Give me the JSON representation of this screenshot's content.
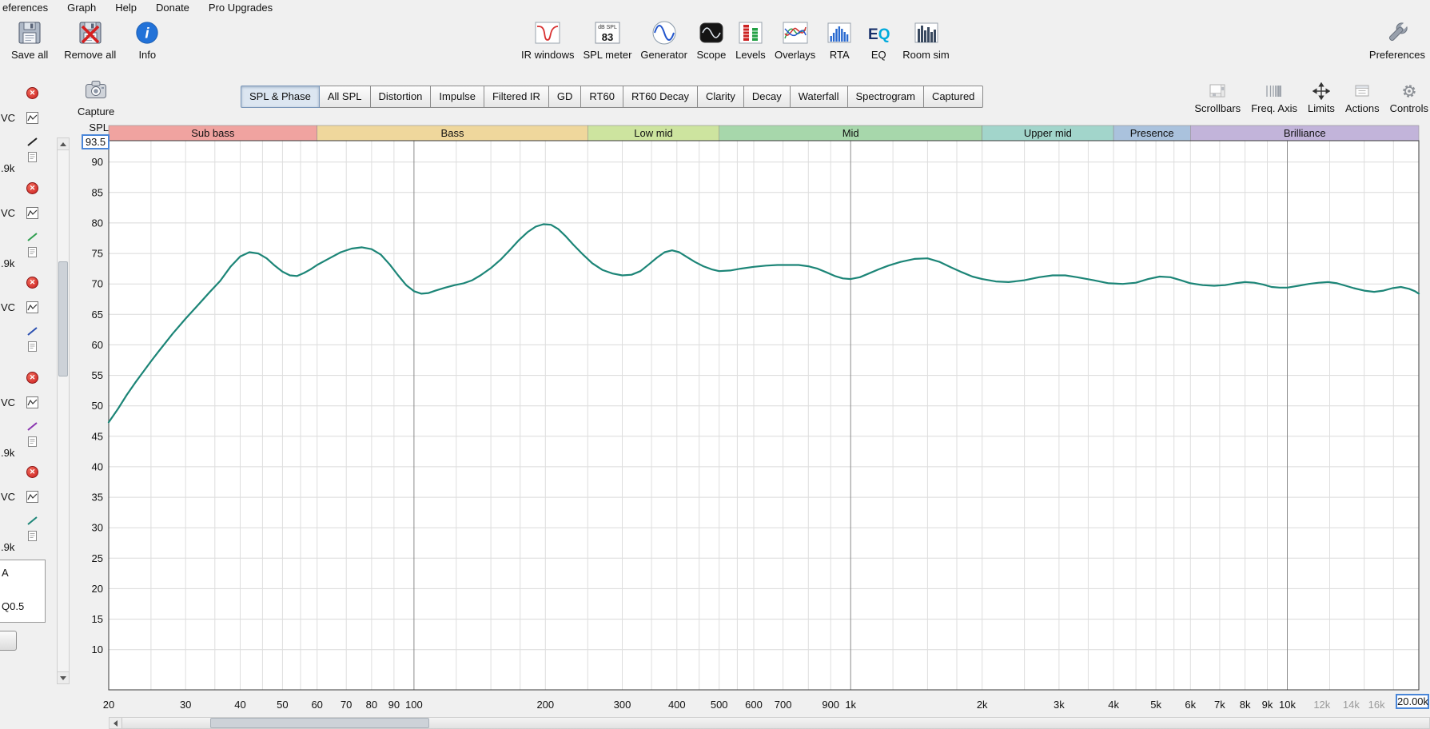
{
  "menu": {
    "items": [
      "eferences",
      "Graph",
      "Help",
      "Donate",
      "Pro Upgrades"
    ]
  },
  "toolbar": {
    "left": [
      {
        "id": "save-all",
        "label": "Save all",
        "icon": "save-icon"
      },
      {
        "id": "remove-all",
        "label": "Remove all",
        "icon": "remove-all-icon"
      },
      {
        "id": "info",
        "label": "Info",
        "icon": "info-icon"
      }
    ],
    "center": [
      {
        "id": "ir-windows",
        "label": "IR windows",
        "icon": "ir-windows-icon"
      },
      {
        "id": "spl-meter",
        "label": "SPL meter",
        "icon": "spl-meter-icon",
        "meter_caption": "dB SPL",
        "meter_value": "83"
      },
      {
        "id": "generator",
        "label": "Generator",
        "icon": "generator-icon"
      },
      {
        "id": "scope",
        "label": "Scope",
        "icon": "scope-icon"
      },
      {
        "id": "levels",
        "label": "Levels",
        "icon": "levels-icon"
      },
      {
        "id": "overlays",
        "label": "Overlays",
        "icon": "overlays-icon"
      },
      {
        "id": "rta",
        "label": "RTA",
        "icon": "rta-icon"
      },
      {
        "id": "eq",
        "label": "EQ",
        "icon": "eq-icon"
      },
      {
        "id": "room-sim",
        "label": "Room sim",
        "icon": "room-sim-icon"
      }
    ],
    "right": [
      {
        "id": "preferences",
        "label": "Preferences",
        "icon": "wrench-icon"
      }
    ]
  },
  "capture": {
    "label": "Capture"
  },
  "tabs": {
    "active": "SPL & Phase",
    "items": [
      "SPL & Phase",
      "All SPL",
      "Distortion",
      "Impulse",
      "Filtered IR",
      "GD",
      "RT60",
      "RT60 Decay",
      "Clarity",
      "Decay",
      "Waterfall",
      "Spectrogram",
      "Captured"
    ]
  },
  "graph_controls": [
    {
      "id": "scrollbars",
      "label": "Scrollbars",
      "icon": "scrollbars-icon"
    },
    {
      "id": "freq-axis",
      "label": "Freq. Axis",
      "icon": "freq-axis-icon"
    },
    {
      "id": "limits",
      "label": "Limits",
      "icon": "limits-icon"
    },
    {
      "id": "actions",
      "label": "Actions",
      "icon": "actions-icon"
    },
    {
      "id": "controls",
      "label": "Controls",
      "icon": "gear-icon"
    }
  ],
  "sidebar": {
    "items": [
      {
        "name_fragment": "VC",
        "range_fragment": ".9k",
        "trace_color": "#222222"
      },
      {
        "name_fragment": "VC",
        "range_fragment": ".9k",
        "trace_color": "#2e9e4f"
      },
      {
        "name_fragment": "VC",
        "range_fragment": "",
        "trace_color": "#2a4fb0"
      },
      {
        "name_fragment": "VC",
        "range_fragment": ".9k",
        "trace_color": "#8a35b0"
      },
      {
        "name_fragment": "VC",
        "range_fragment": ".9k",
        "trace_color": "#1c8577"
      }
    ],
    "bottom_box": {
      "line1": "A",
      "line2": "Q0.5"
    }
  },
  "chart_data": {
    "type": "line",
    "title": "",
    "xlabel": "",
    "ylabel": "SPL",
    "x_scale": "log",
    "xlim": [
      20,
      20000
    ],
    "ylim": [
      3.4,
      93.5
    ],
    "y_top_limit": "93.5",
    "x_right_limit": "20.00k",
    "grid": true,
    "y_ticks": [
      90,
      85,
      80,
      75,
      70,
      65,
      60,
      55,
      50,
      45,
      40,
      35,
      30,
      25,
      20,
      15,
      10
    ],
    "x_ticks": [
      {
        "f": 20,
        "label": "20"
      },
      {
        "f": 30,
        "label": "30"
      },
      {
        "f": 40,
        "label": "40"
      },
      {
        "f": 50,
        "label": "50"
      },
      {
        "f": 60,
        "label": "60"
      },
      {
        "f": 70,
        "label": "70"
      },
      {
        "f": 80,
        "label": "80"
      },
      {
        "f": 90,
        "label": "90"
      },
      {
        "f": 100,
        "label": "100"
      },
      {
        "f": 200,
        "label": "200"
      },
      {
        "f": 300,
        "label": "300"
      },
      {
        "f": 400,
        "label": "400"
      },
      {
        "f": 500,
        "label": "500"
      },
      {
        "f": 600,
        "label": "600"
      },
      {
        "f": 700,
        "label": "700"
      },
      {
        "f": 900,
        "label": "900"
      },
      {
        "f": 1000,
        "label": "1k"
      },
      {
        "f": 2000,
        "label": "2k"
      },
      {
        "f": 3000,
        "label": "3k"
      },
      {
        "f": 4000,
        "label": "4k"
      },
      {
        "f": 5000,
        "label": "5k"
      },
      {
        "f": 6000,
        "label": "6k"
      },
      {
        "f": 7000,
        "label": "7k"
      },
      {
        "f": 8000,
        "label": "8k"
      },
      {
        "f": 9000,
        "label": "9k"
      },
      {
        "f": 10000,
        "label": "10k"
      },
      {
        "f": 12000,
        "label": "12k",
        "muted": true
      },
      {
        "f": 14000,
        "label": "14k",
        "muted": true
      },
      {
        "f": 16000,
        "label": "16k",
        "muted": true
      }
    ],
    "x_gridlines": [
      20,
      25,
      30,
      35,
      40,
      45,
      50,
      55,
      60,
      70,
      80,
      90,
      100,
      125,
      150,
      175,
      200,
      250,
      300,
      350,
      400,
      450,
      500,
      550,
      600,
      700,
      800,
      900,
      1000,
      1250,
      1500,
      1750,
      2000,
      2500,
      3000,
      3500,
      4000,
      4500,
      5000,
      5500,
      6000,
      7000,
      8000,
      9000,
      10000,
      12500,
      15000,
      17500,
      20000
    ],
    "x_major_gridlines": [
      100,
      1000,
      10000
    ],
    "bands": [
      {
        "label": "Sub bass",
        "from": 20,
        "to": 60,
        "color": "#f0a3a0"
      },
      {
        "label": "Bass",
        "from": 60,
        "to": 250,
        "color": "#efd79c"
      },
      {
        "label": "Low mid",
        "from": 250,
        "to": 500,
        "color": "#cde49f"
      },
      {
        "label": "Mid",
        "from": 500,
        "to": 2000,
        "color": "#a7d7ab"
      },
      {
        "label": "Upper mid",
        "from": 2000,
        "to": 4000,
        "color": "#a2d5cb"
      },
      {
        "label": "Presence",
        "from": 4000,
        "to": 6000,
        "color": "#aac2dd"
      },
      {
        "label": "Brilliance",
        "from": 6000,
        "to": 20000,
        "color": "#c2b4da"
      }
    ],
    "series": [
      {
        "name": "SPL measurement",
        "color": "#1c8577",
        "points": [
          [
            20,
            47.3
          ],
          [
            21,
            49.5
          ],
          [
            22,
            51.8
          ],
          [
            23,
            53.8
          ],
          [
            24,
            55.6
          ],
          [
            25,
            57.3
          ],
          [
            26,
            58.9
          ],
          [
            28,
            61.8
          ],
          [
            30,
            64.3
          ],
          [
            32,
            66.5
          ],
          [
            34,
            68.6
          ],
          [
            36,
            70.5
          ],
          [
            38,
            72.8
          ],
          [
            40,
            74.5
          ],
          [
            42,
            75.2
          ],
          [
            44,
            75.0
          ],
          [
            46,
            74.2
          ],
          [
            48,
            73.0
          ],
          [
            50,
            72.0
          ],
          [
            52,
            71.4
          ],
          [
            54,
            71.3
          ],
          [
            56,
            71.8
          ],
          [
            58,
            72.4
          ],
          [
            60,
            73.1
          ],
          [
            64,
            74.2
          ],
          [
            68,
            75.2
          ],
          [
            72,
            75.8
          ],
          [
            76,
            76.0
          ],
          [
            80,
            75.7
          ],
          [
            84,
            74.8
          ],
          [
            88,
            73.2
          ],
          [
            92,
            71.4
          ],
          [
            96,
            69.8
          ],
          [
            100,
            68.8
          ],
          [
            104,
            68.4
          ],
          [
            108,
            68.5
          ],
          [
            112,
            68.9
          ],
          [
            118,
            69.4
          ],
          [
            124,
            69.8
          ],
          [
            130,
            70.1
          ],
          [
            136,
            70.6
          ],
          [
            142,
            71.4
          ],
          [
            150,
            72.6
          ],
          [
            158,
            74.0
          ],
          [
            166,
            75.6
          ],
          [
            174,
            77.2
          ],
          [
            182,
            78.5
          ],
          [
            190,
            79.4
          ],
          [
            198,
            79.8
          ],
          [
            206,
            79.7
          ],
          [
            214,
            79.0
          ],
          [
            222,
            77.9
          ],
          [
            232,
            76.4
          ],
          [
            244,
            74.8
          ],
          [
            256,
            73.4
          ],
          [
            270,
            72.3
          ],
          [
            285,
            71.7
          ],
          [
            300,
            71.4
          ],
          [
            315,
            71.5
          ],
          [
            330,
            72.1
          ],
          [
            345,
            73.2
          ],
          [
            360,
            74.3
          ],
          [
            375,
            75.2
          ],
          [
            390,
            75.5
          ],
          [
            405,
            75.2
          ],
          [
            420,
            74.5
          ],
          [
            440,
            73.6
          ],
          [
            460,
            72.9
          ],
          [
            480,
            72.4
          ],
          [
            500,
            72.1
          ],
          [
            530,
            72.2
          ],
          [
            560,
            72.5
          ],
          [
            600,
            72.8
          ],
          [
            640,
            73.0
          ],
          [
            680,
            73.1
          ],
          [
            720,
            73.1
          ],
          [
            760,
            73.1
          ],
          [
            800,
            72.9
          ],
          [
            840,
            72.5
          ],
          [
            880,
            71.9
          ],
          [
            920,
            71.3
          ],
          [
            960,
            70.9
          ],
          [
            1000,
            70.8
          ],
          [
            1050,
            71.1
          ],
          [
            1100,
            71.7
          ],
          [
            1160,
            72.4
          ],
          [
            1220,
            73.0
          ],
          [
            1300,
            73.6
          ],
          [
            1400,
            74.1
          ],
          [
            1500,
            74.2
          ],
          [
            1600,
            73.6
          ],
          [
            1700,
            72.7
          ],
          [
            1800,
            71.9
          ],
          [
            1900,
            71.2
          ],
          [
            2000,
            70.8
          ],
          [
            2150,
            70.4
          ],
          [
            2300,
            70.3
          ],
          [
            2500,
            70.6
          ],
          [
            2700,
            71.1
          ],
          [
            2900,
            71.4
          ],
          [
            3100,
            71.4
          ],
          [
            3300,
            71.1
          ],
          [
            3600,
            70.6
          ],
          [
            3900,
            70.1
          ],
          [
            4200,
            70.0
          ],
          [
            4500,
            70.2
          ],
          [
            4800,
            70.8
          ],
          [
            5100,
            71.2
          ],
          [
            5400,
            71.1
          ],
          [
            5700,
            70.6
          ],
          [
            6000,
            70.1
          ],
          [
            6400,
            69.8
          ],
          [
            6800,
            69.7
          ],
          [
            7200,
            69.8
          ],
          [
            7600,
            70.1
          ],
          [
            8000,
            70.3
          ],
          [
            8400,
            70.2
          ],
          [
            8800,
            69.9
          ],
          [
            9200,
            69.5
          ],
          [
            9600,
            69.4
          ],
          [
            10000,
            69.4
          ],
          [
            10600,
            69.7
          ],
          [
            11200,
            70.0
          ],
          [
            11800,
            70.2
          ],
          [
            12400,
            70.3
          ],
          [
            13000,
            70.1
          ],
          [
            13600,
            69.7
          ],
          [
            14200,
            69.3
          ],
          [
            15000,
            68.9
          ],
          [
            15800,
            68.7
          ],
          [
            16600,
            68.9
          ],
          [
            17400,
            69.3
          ],
          [
            18200,
            69.5
          ],
          [
            19000,
            69.2
          ],
          [
            19600,
            68.8
          ],
          [
            20000,
            68.4
          ]
        ]
      }
    ]
  }
}
